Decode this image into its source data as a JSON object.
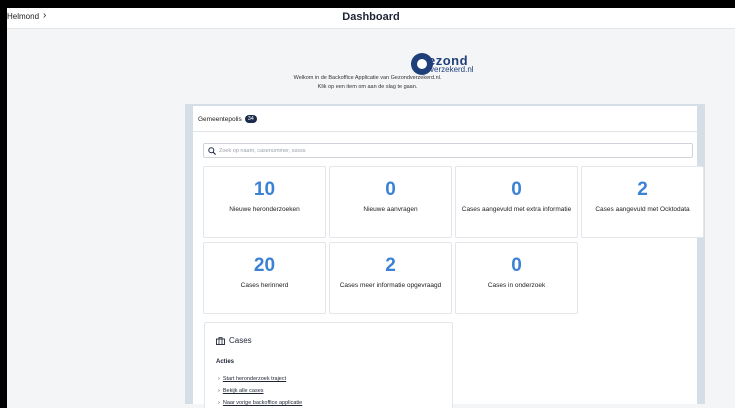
{
  "header": {
    "breadcrumb": "Helmond",
    "title": "Dashboard"
  },
  "brand": {
    "line1": "ezond",
    "line2": "verzekerd.nl",
    "color": "#1f3f7a"
  },
  "welcome": {
    "line1": "Welkom in de Backoffice Applicatie van Gezondverzekerd.nl.",
    "line2": "Klik op een item om aan de slag te gaan."
  },
  "tabs": [
    {
      "label": "Gemeentepolis",
      "count": "34"
    }
  ],
  "search": {
    "placeholder": "Zoek op naam, casenummer, sssss"
  },
  "tiles": [
    {
      "number": "10",
      "label": "Nieuwe heronderzoeken"
    },
    {
      "number": "0",
      "label": "Nieuwe aanvragen"
    },
    {
      "number": "0",
      "label": "Cases aangevuld met extra informatie"
    },
    {
      "number": "2",
      "label": "Cases aangevuld met Ocktodata"
    },
    {
      "number": "20",
      "label": "Cases herinnerd"
    },
    {
      "number": "2",
      "label": "Cases meer informatie opgevraagd"
    },
    {
      "number": "0",
      "label": "Cases in onderzoek"
    }
  ],
  "cases": {
    "title": "Cases",
    "actions_label": "Acties",
    "links": [
      "Start heronderzoek traject",
      "Bekijk alle cases",
      "Naar vorige backoffice applicatie"
    ]
  },
  "colors": {
    "accent": "#3b82d6",
    "badge": "#1d2b4a",
    "panel_border": "#d5dde6"
  }
}
